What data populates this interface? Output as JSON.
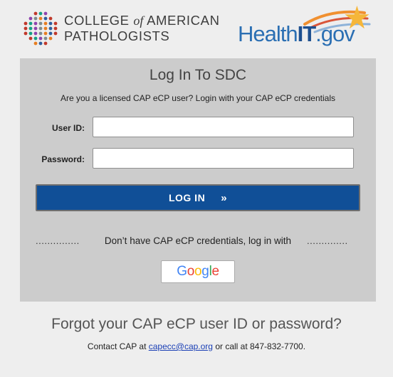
{
  "header": {
    "cap_logo": {
      "line1_pre": "COLLEGE ",
      "line1_of": "of",
      "line1_post": " AMERICAN",
      "line2": "PATHOLOGISTS"
    },
    "healthit_logo": {
      "health": "Health",
      "it": "IT",
      "gov": ".gov"
    }
  },
  "login_panel": {
    "title": "Log In To SDC",
    "subtitle": "Are you a licensed CAP eCP user? Login with your CAP eCP credentials",
    "user_id_label": "User ID:",
    "user_id_value": "",
    "password_label": "Password:",
    "password_value": "",
    "login_button_label": "LOG IN",
    "login_button_arrow": "»",
    "alt_dots_left": "...............",
    "alt_dots_right": "..............",
    "alt_text": "Don’t have CAP eCP credentials, log in with",
    "google": {
      "g1": "G",
      "o1": "o",
      "o2": "o",
      "g2": "g",
      "l": "l",
      "e": "e"
    }
  },
  "footer": {
    "forgot_text": "Forgot your CAP eCP user ID or password?",
    "contact_pre": "Contact CAP at ",
    "contact_email": "capecc@cap.org",
    "contact_post": " or call at 847-832-7700."
  },
  "colors": {
    "background": "#eeeeee",
    "panel": "#cccccc",
    "login_button": "#104f97",
    "google_blue": "#4285F4",
    "google_red": "#EA4335",
    "google_yellow": "#FBBC05",
    "google_green": "#34A853"
  }
}
